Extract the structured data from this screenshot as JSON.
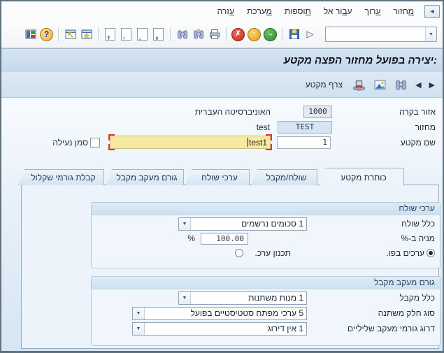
{
  "window": {
    "title_bar_text": ":יצירה בפועל מחזור הפצה מקטע"
  },
  "menu": {
    "items": [
      {
        "pre": "",
        "key": "מ",
        "post": "חזור"
      },
      {
        "pre": "",
        "key": "ע",
        "post": "רוך"
      },
      {
        "pre": "ע",
        "key": "ב",
        "post": "ור אל"
      },
      {
        "pre": "",
        "key": "ת",
        "post": "וספות"
      },
      {
        "pre": "",
        "key": "מ",
        "post": "ערכת"
      },
      {
        "pre": "",
        "key": "ע",
        "post": "זרה"
      }
    ]
  },
  "toolbar": {
    "command_value": "",
    "icon_names": [
      "customize-layout",
      "help",
      "new-session",
      "create-shortcut",
      "page-first",
      "page-up",
      "page-down",
      "page-last",
      "find",
      "find-next",
      "print",
      "cancel",
      "exit",
      "forward",
      "save",
      "continue",
      "command-dropdown",
      "enter-check"
    ]
  },
  "icons": {
    "dropdown": "▼",
    "next": "▶",
    "prev": "◀",
    "check": "✓",
    "cancel": "✗",
    "up": "↑",
    "forward": "→",
    "help": "?",
    "play": "▷",
    "star": "✷",
    "win_arrow": "↗",
    "sys_arrow": "◄",
    "page_first": "↟",
    "page_up": "↑",
    "page_down": "↓",
    "page_last": "↡"
  },
  "app_toolbar": {
    "attach_segment_label": "צרף מקטע"
  },
  "fields": {
    "control_area": {
      "label": "אזור בקרה",
      "value": "1000",
      "desc": "האוניברסיטה העברית"
    },
    "cycle": {
      "label": "מחזור",
      "value": "TEST",
      "desc": "test"
    },
    "segment": {
      "label": "שם מקטע",
      "value": "1",
      "name_value": "test1",
      "lock_label": "סמן נעילה",
      "lock_checked": false
    }
  },
  "tabs": [
    "כותרת מקטע",
    "שולח/מקבל",
    "ערכי שולח",
    "גורם מעקב מקבל",
    "קבלת גורמי שקלול"
  ],
  "active_tab": "כותרת מקטע",
  "sender_box": {
    "title": "ערכי שולח",
    "rule_label": "כלל שולח",
    "rule_value": "1 סכומים נרשמים",
    "share_label": "מניה ב-%",
    "share_value": "100.00",
    "percent_sign": "%",
    "radio_actual_label": "ערכים בפו.",
    "radio_plan_label": "תכנון ערכ.",
    "radio_selected": "ערכים בפו."
  },
  "receiver_box": {
    "title": "גורם מעקב מקבל",
    "rule_label": "כלל מקבל",
    "rule_value": "1 מנות משתנות",
    "var_portion_label": "סוג חלק משתנה",
    "var_portion_value": "5 ערכי מפתח סטטיסטיים בפועל",
    "scaling_label": "דרוג גורמי מעקב שליליים",
    "scaling_value": "1 אין דירוג"
  },
  "colors": {
    "title_bar": "#c5d8ea",
    "app_toolbar": "#d5e4f2",
    "panel": "#ecf3fa",
    "focus_field_yellow": "#f7e9a4",
    "focus_brackets_red": "#d93a2b",
    "readonly_blue_field": "#d7e5f2",
    "readonly_gray_field": "#e3e9ef"
  }
}
